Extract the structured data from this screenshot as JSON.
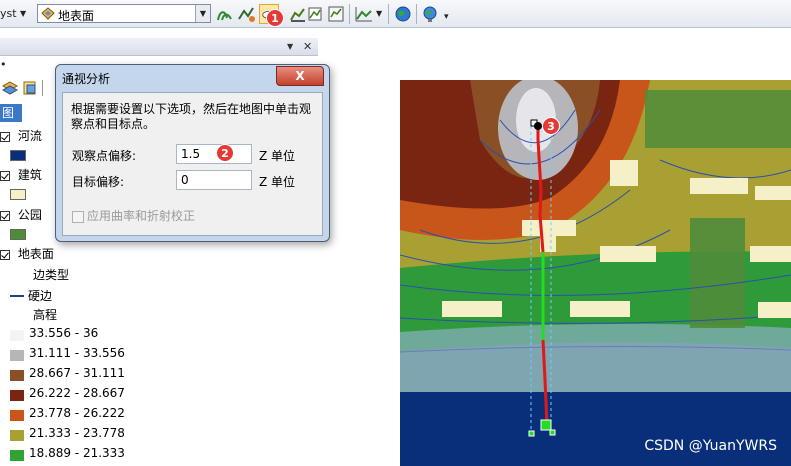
{
  "toolbar": {
    "left_text": "yst",
    "layer_combo_value": "地表面",
    "markers": {
      "m1": "1"
    }
  },
  "toc": {
    "selected_tab": "图层",
    "layers": [
      {
        "name": "河流",
        "color": "#0a2f7a"
      },
      {
        "name": "建筑",
        "color": "#f5f0c8"
      },
      {
        "name": "公园",
        "color": "#4f8c3a"
      },
      {
        "name": "地表面",
        "color": ""
      }
    ],
    "surface": {
      "edge_type_label": "边类型",
      "hard_edge_label": "硬边",
      "elevation_label": "高程"
    },
    "legend": [
      {
        "label": "33.556 - 36",
        "color": "#f4f4f4"
      },
      {
        "label": "31.111 - 33.556",
        "color": "#b6b6ba"
      },
      {
        "label": "28.667 - 31.111",
        "color": "#8b4f26"
      },
      {
        "label": "26.222 - 28.667",
        "color": "#7a2412"
      },
      {
        "label": "23.778 - 26.222",
        "color": "#c8561a"
      },
      {
        "label": "21.333 - 23.778",
        "color": "#a8a032"
      },
      {
        "label": "18.889 - 21.333",
        "color": "#33a233"
      }
    ]
  },
  "dialog": {
    "title": "通视分析",
    "close_label": "X",
    "description": "根据需要设置以下选项，然后在地图中单击观察点和目标点。",
    "observer_offset_label": "观察点偏移:",
    "observer_offset_value": "1.5",
    "target_offset_label": "目标偏移:",
    "target_offset_value": "0",
    "unit_label_1": "Z 单位",
    "unit_label_2": "Z 单位",
    "curvature_label": "应用曲率和折射校正",
    "markers": {
      "m2": "2"
    }
  },
  "map": {
    "markers": {
      "m3": "3"
    }
  },
  "watermark": "CSDN @YuanYWRS"
}
